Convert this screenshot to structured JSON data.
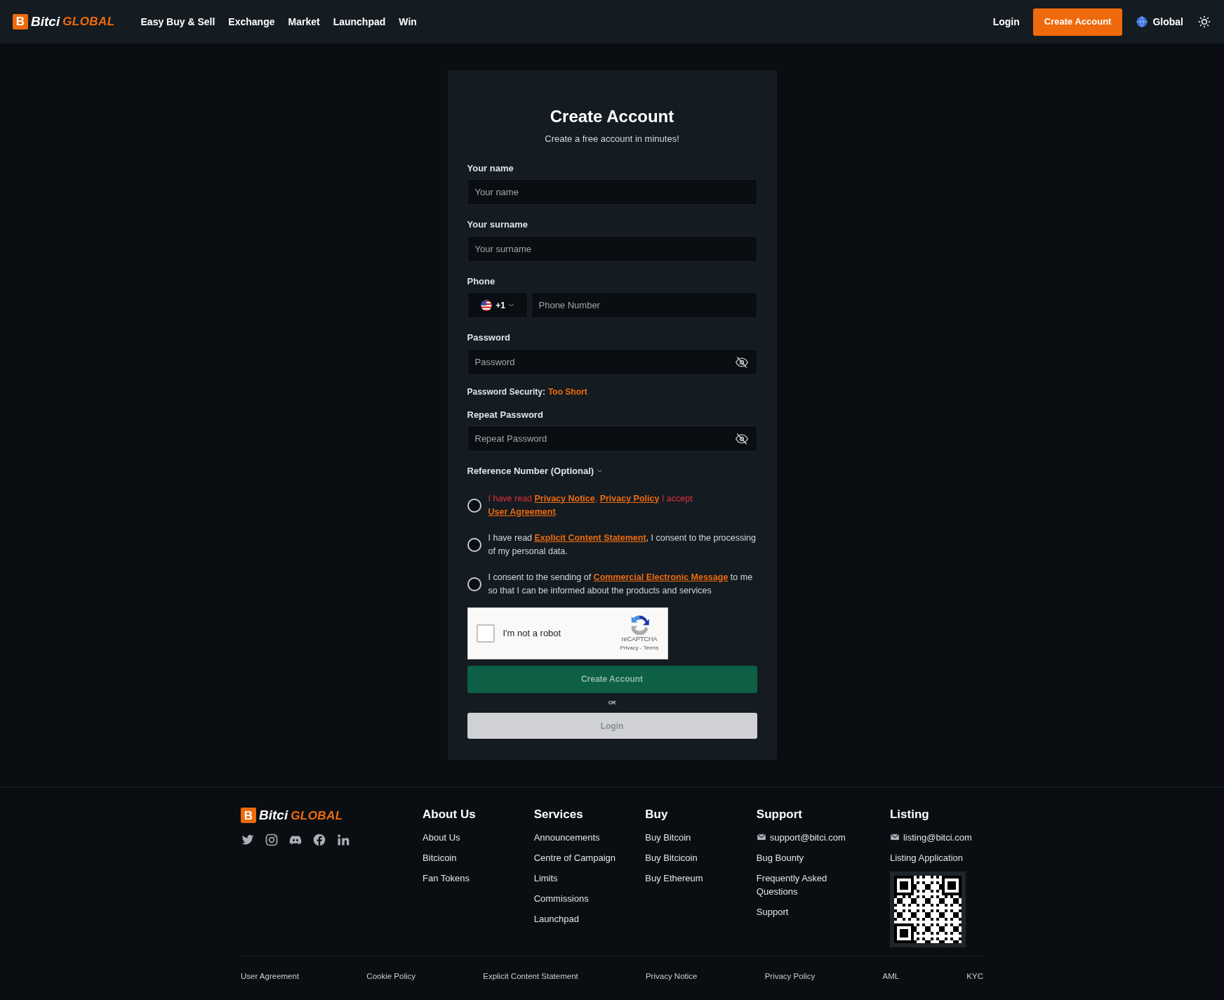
{
  "header": {
    "logo": {
      "mark": "B",
      "name": "Bitci",
      "suffix": "GLOBAL"
    },
    "nav": [
      {
        "label": "Easy Buy & Sell"
      },
      {
        "label": "Exchange"
      },
      {
        "label": "Market"
      },
      {
        "label": "Launchpad"
      },
      {
        "label": "Win"
      }
    ],
    "login": "Login",
    "create_account": "Create Account",
    "region": "Global"
  },
  "form": {
    "title": "Create Account",
    "subtitle": "Create a free account in minutes!",
    "fields": [
      {
        "kind": "text",
        "label": "Your name",
        "placeholder": "Your name"
      },
      {
        "kind": "text",
        "label": "Your surname",
        "placeholder": "Your surname"
      },
      {
        "kind": "phone",
        "label": "Phone",
        "code": "+1",
        "placeholder": "Phone Number"
      },
      {
        "kind": "password",
        "label": "Password",
        "placeholder": "Password",
        "security_label": "Password Security:",
        "security_value": "Too Short"
      },
      {
        "kind": "password",
        "label": "Repeat Password",
        "placeholder": "Repeat Password"
      }
    ],
    "reference": "Reference Number (Optional)",
    "consents": [
      {
        "checked": false,
        "error": true,
        "parts": [
          {
            "kind": "text",
            "text": "I have read "
          },
          {
            "kind": "link",
            "text": "Privacy Notice"
          },
          {
            "kind": "text",
            "text": ", "
          },
          {
            "kind": "link",
            "text": "Privacy Policy"
          },
          {
            "kind": "text",
            "text": " I accept "
          },
          {
            "kind": "link",
            "text": "User Agreement"
          },
          {
            "kind": "text",
            "text": "."
          }
        ]
      },
      {
        "checked": false,
        "error": false,
        "parts": [
          {
            "kind": "text",
            "text": "I have read "
          },
          {
            "kind": "link",
            "text": "Explicit Content Statement"
          },
          {
            "kind": "text",
            "text": ", I consent to the processing of my personal data."
          }
        ]
      },
      {
        "checked": false,
        "error": false,
        "parts": [
          {
            "kind": "text",
            "text": "I consent to the sending of "
          },
          {
            "kind": "link",
            "text": "Commercial Electronic Message"
          },
          {
            "kind": "text",
            "text": " to me so that I can be informed about the products and services"
          }
        ]
      }
    ],
    "captcha": {
      "checked": false,
      "label": "I'm not a robot",
      "brand": "reCAPTCHA",
      "links": "Privacy - Terms"
    },
    "submit": "Create Account",
    "or": "OR",
    "login": "Login"
  },
  "footer": {
    "logo": {
      "mark": "B",
      "name": "Bitci",
      "suffix": "GLOBAL"
    },
    "columns": [
      {
        "title": "About Us",
        "links": [
          {
            "text": "About Us"
          },
          {
            "text": "Bitcicoin"
          },
          {
            "text": "Fan Tokens"
          }
        ]
      },
      {
        "title": "Services",
        "links": [
          {
            "text": "Announcements"
          },
          {
            "text": "Centre of Campaign"
          },
          {
            "text": "Limits"
          },
          {
            "text": "Commissions"
          },
          {
            "text": "Launchpad"
          }
        ]
      },
      {
        "title": "Buy",
        "links": [
          {
            "text": "Buy Bitcoin"
          },
          {
            "text": "Buy Bitcicoin"
          },
          {
            "text": "Buy Ethereum"
          }
        ]
      },
      {
        "title": "Support",
        "links": [
          {
            "text": "support@bitci.com",
            "kind": "email"
          },
          {
            "text": "Bug Bounty"
          },
          {
            "text": "Frequently Asked Questions"
          },
          {
            "text": "Support"
          }
        ]
      },
      {
        "title": "Listing",
        "links": [
          {
            "text": "listing@bitci.com",
            "kind": "email"
          },
          {
            "text": "Listing Application"
          }
        ],
        "qr": true
      }
    ],
    "legal": [
      "User Agreement",
      "Cookie Policy",
      "Explicit Content Statement",
      "Privacy Notice",
      "Privacy Policy",
      "AML",
      "KYC"
    ]
  }
}
